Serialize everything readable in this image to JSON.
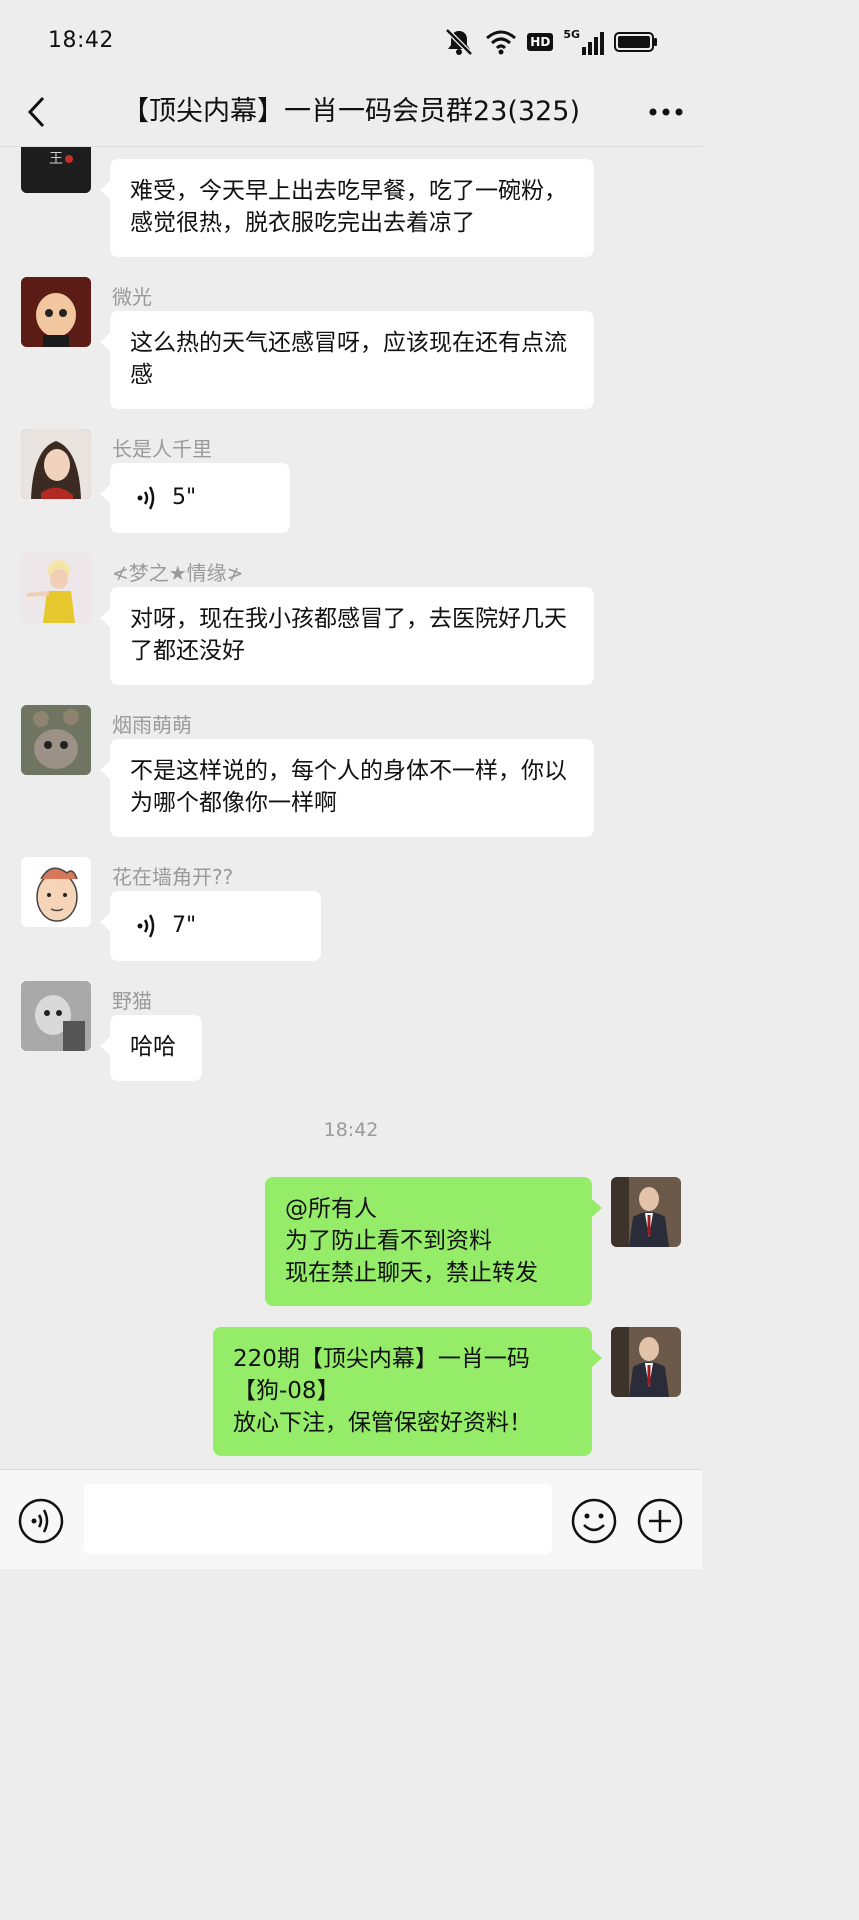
{
  "status_bar": {
    "time": "18:42",
    "hd_label": "HD",
    "network_label": "5G"
  },
  "header": {
    "title": "【顶尖内幕】一肖一码会员群23(325)"
  },
  "messages": [
    {
      "sender": "",
      "text": "难受，今天早上出去吃早餐，吃了一碗粉，感觉很热，脱衣服吃完出去着凉了"
    },
    {
      "sender": "微光",
      "text": "这么热的天气还感冒呀，应该现在还有点流感"
    },
    {
      "sender": "长是人千里",
      "voice_duration": "5\""
    },
    {
      "sender": "≮梦之★情缘≯",
      "text": "对呀，现在我小孩都感冒了，去医院好几天了都还没好"
    },
    {
      "sender": "烟雨萌萌",
      "text": "不是这样说的，每个人的身体不一样，你以为哪个都像你一样啊"
    },
    {
      "sender": "花在墙角开??",
      "voice_duration": "7\""
    },
    {
      "sender": "野猫",
      "text": "哈哈"
    }
  ],
  "timestamp": "18:42",
  "outgoing": [
    {
      "lines": [
        "@所有人",
        "为了防止看不到资料",
        "现在禁止聊天，禁止转发"
      ]
    },
    {
      "lines": [
        "220期【顶尖内幕】一肖一码",
        "【狗-08】",
        "放心下注，保管保密好资料！"
      ]
    }
  ],
  "input": {
    "placeholder": ""
  },
  "colors": {
    "background": "#ededed",
    "outgoing_bubble": "#95ec69",
    "incoming_bubble": "#ffffff",
    "sender_name": "#9a9a9a"
  }
}
